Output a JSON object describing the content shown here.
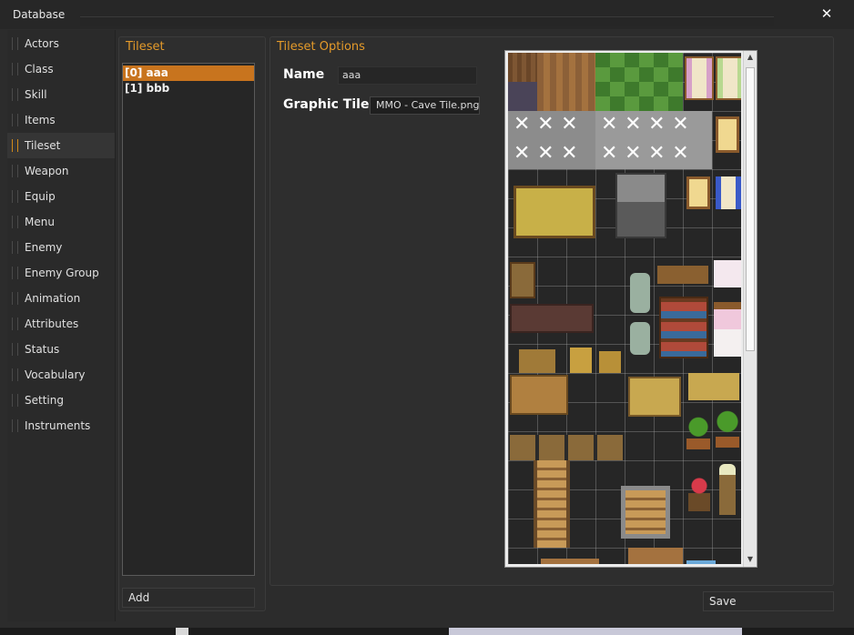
{
  "window": {
    "title": "Database",
    "close_icon": "close-icon"
  },
  "nav": {
    "items": [
      {
        "label": "Actors",
        "active": false
      },
      {
        "label": "Class",
        "active": false
      },
      {
        "label": "Skill",
        "active": false
      },
      {
        "label": "Items",
        "active": false
      },
      {
        "label": "Tileset",
        "active": true
      },
      {
        "label": "Weapon",
        "active": false
      },
      {
        "label": "Equip",
        "active": false
      },
      {
        "label": "Menu",
        "active": false
      },
      {
        "label": "Enemy",
        "active": false
      },
      {
        "label": "Enemy Group",
        "active": false
      },
      {
        "label": "Animation",
        "active": false
      },
      {
        "label": "Attributes",
        "active": false
      },
      {
        "label": "Status",
        "active": false
      },
      {
        "label": "Vocabulary",
        "active": false
      },
      {
        "label": "Setting",
        "active": false
      },
      {
        "label": "Instruments",
        "active": false
      }
    ]
  },
  "tileset_list": {
    "title": "Tileset",
    "items": [
      "[0] aaa",
      "[1] bbb"
    ],
    "selected_index": 0,
    "add_label": "Add"
  },
  "options": {
    "title": "Tileset Options",
    "name_label": "Name",
    "name_value": "aaa",
    "graphic_label": "Graphic Tile",
    "graphic_value": "MMO - Cave Tile.png"
  },
  "footer": {
    "save_label": "Save"
  },
  "colors": {
    "accent": "#e49a2a",
    "selected": "#c8741e",
    "background": "#2c2c2c"
  }
}
